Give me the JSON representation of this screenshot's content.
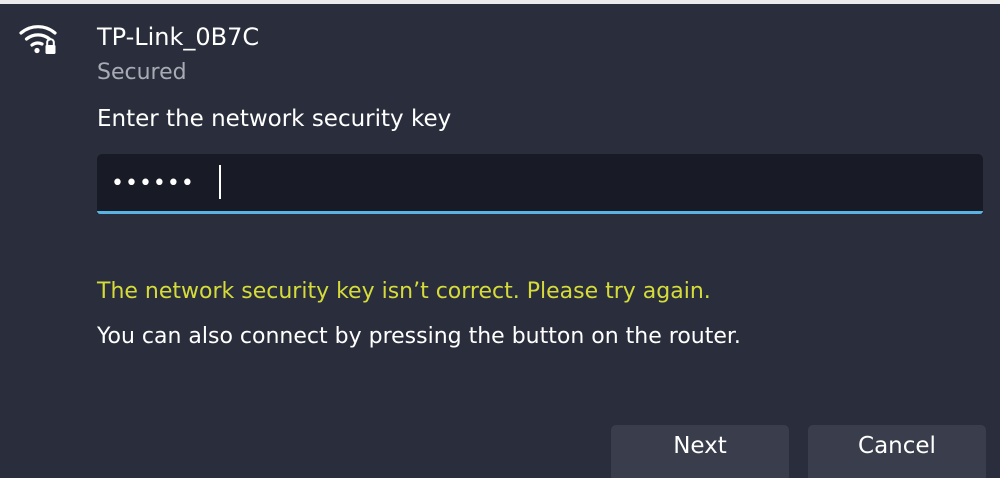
{
  "network": {
    "name": "TP-Link_0B7C",
    "status": "Secured",
    "icon": "wifi-secured-icon"
  },
  "key_field": {
    "label": "Enter the network security key",
    "value": "••••••",
    "active_accent_color": "#5ab4e2"
  },
  "messages": {
    "error": "The network security key isn’t correct. Please try again.",
    "error_color": "#d5dc3a",
    "info": "You can also connect by pressing the button on the router."
  },
  "buttons": {
    "next_label": "Next",
    "cancel_label": "Cancel"
  }
}
